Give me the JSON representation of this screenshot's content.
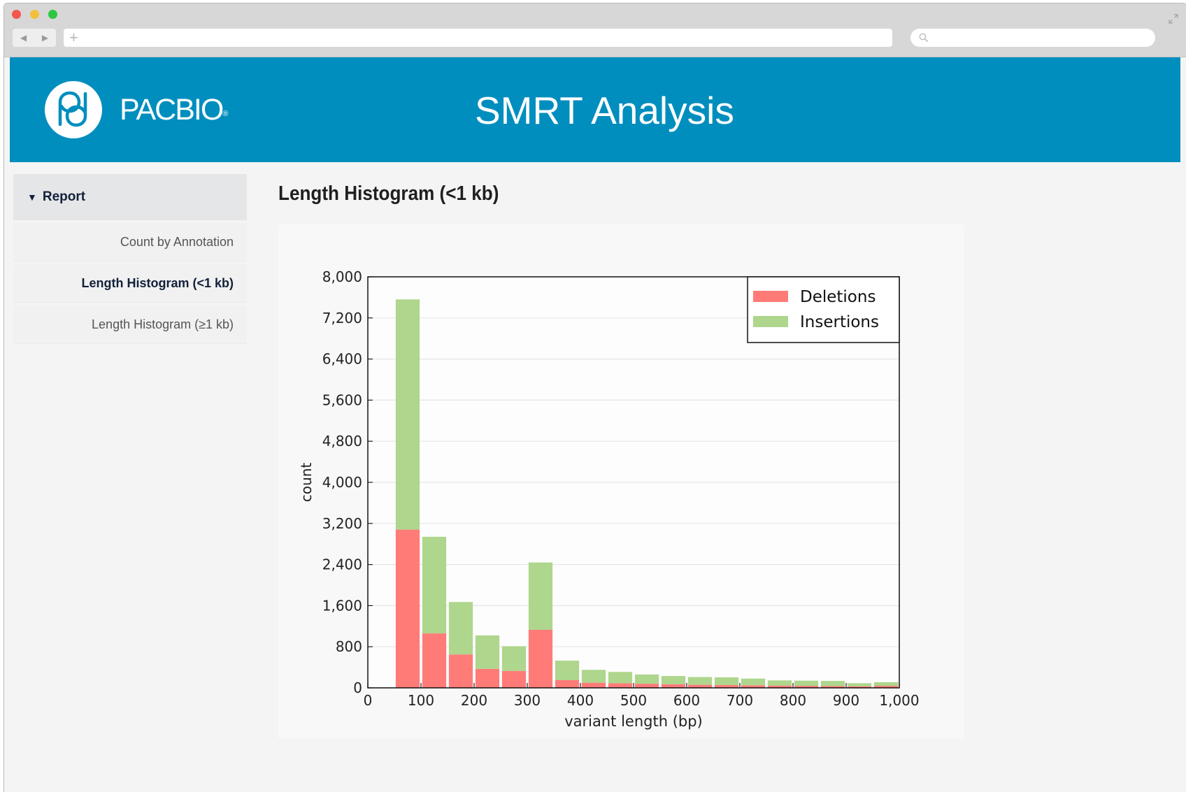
{
  "browser": {
    "back_glyph": "◀",
    "forward_glyph": "▶",
    "new_tab_glyph": "+",
    "icons": [
      "close-dot",
      "minimize-dot",
      "zoom-dot",
      "search-icon",
      "expand-icon"
    ]
  },
  "header": {
    "brand": "PACBIO",
    "registered": "®",
    "app_title": "SMRT Analysis",
    "background_color": "#008ebe"
  },
  "sidebar": {
    "section_label": "Report",
    "section_glyph": "▼",
    "items": [
      {
        "label": "Count by Annotation",
        "active": false
      },
      {
        "label": "Length Histogram (<1 kb)",
        "active": true
      },
      {
        "label": "Length Histogram (≥1 kb)",
        "active": false
      }
    ]
  },
  "main": {
    "title": "Length Histogram (<1 kb)"
  },
  "chart_data": {
    "type": "bar",
    "stacked": true,
    "xlabel": "variant length (bp)",
    "ylabel": "count",
    "xlim": [
      0,
      1000
    ],
    "ylim": [
      0,
      8000
    ],
    "xticks": [
      "0",
      "100",
      "200",
      "300",
      "400",
      "500",
      "600",
      "700",
      "800",
      "900",
      "1,000"
    ],
    "yticks": [
      "0",
      "800",
      "1,600",
      "2,400",
      "3,200",
      "4,000",
      "4,800",
      "5,600",
      "6,400",
      "7,200",
      "8,000"
    ],
    "grid": "horizontal",
    "legend_position": "top-right",
    "bin_starts": [
      50,
      100,
      150,
      200,
      250,
      300,
      350,
      400,
      450,
      500,
      550,
      600,
      650,
      700,
      750,
      800,
      850,
      900,
      950
    ],
    "bin_width": 50,
    "series": [
      {
        "name": "Deletions",
        "color": "#fe7b78",
        "values": [
          3080,
          1060,
          650,
          370,
          330,
          1130,
          150,
          100,
          90,
          80,
          70,
          60,
          55,
          50,
          45,
          40,
          35,
          30,
          40
        ]
      },
      {
        "name": "Insertions",
        "color": "#aed68c",
        "values": [
          4480,
          1880,
          1020,
          650,
          480,
          1310,
          380,
          250,
          220,
          180,
          160,
          150,
          150,
          130,
          100,
          100,
          100,
          60,
          70
        ]
      }
    ]
  }
}
